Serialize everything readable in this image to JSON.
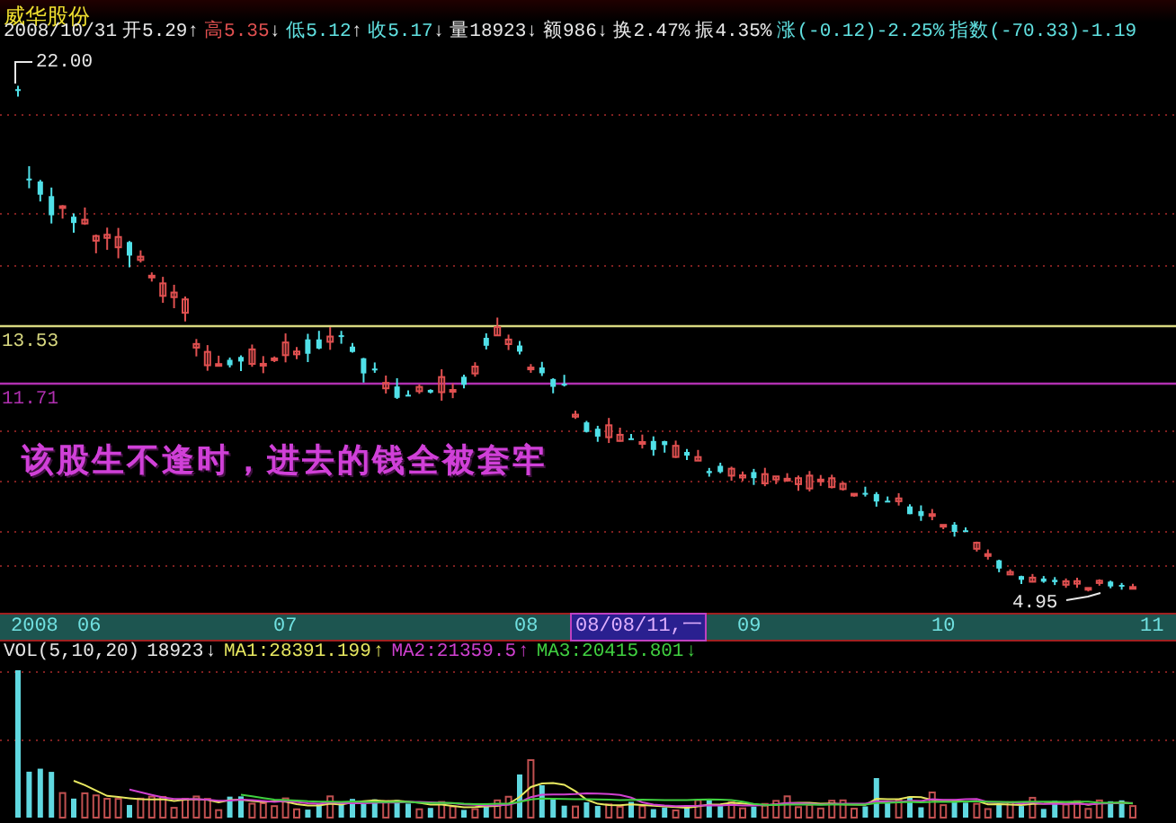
{
  "header": {
    "stock_name": "威华股份"
  },
  "quote": [
    {
      "text": "2008/10/31",
      "color": "#e8e8e8"
    },
    {
      "text": "开5.29",
      "arrow": "↑",
      "color": "#e8e8e8"
    },
    {
      "text": "高5.35",
      "arrow": "↓",
      "color": "#e05050"
    },
    {
      "text": "低5.12",
      "arrow": "↑",
      "color": "#60e0e0"
    },
    {
      "text": "收5.17",
      "arrow": "↓",
      "color": "#60e0e0"
    },
    {
      "text": "量18923",
      "arrow": "↓",
      "color": "#e8e8e8"
    },
    {
      "text": "额986",
      "arrow": "↓",
      "color": "#e8e8e8"
    },
    {
      "text": "换2.47%",
      "color": "#e8e8e8"
    },
    {
      "text": "振4.35%",
      "color": "#e8e8e8"
    },
    {
      "text": "涨(-0.12)-2.25%",
      "color": "#60e0e0"
    },
    {
      "text": "指数(-70.33)-1.19",
      "color": "#60e0e0"
    }
  ],
  "price_chart": {
    "markers": [
      {
        "kind": "high",
        "text": "22.00"
      },
      {
        "kind": "low",
        "text": "4.95"
      }
    ],
    "lines": [
      {
        "text": "13.53",
        "color": "#d8d880"
      },
      {
        "text": "11.71",
        "color": "#b030b0"
      }
    ],
    "annotation": "该股生不逢时，进去的钱全被套牢"
  },
  "date_axis": [
    {
      "text": "2008",
      "selected": false
    },
    {
      "text": "06",
      "selected": false
    },
    {
      "text": "07",
      "selected": false
    },
    {
      "text": "08",
      "selected": false
    },
    {
      "text": "08/08/11,一",
      "selected": true
    },
    {
      "text": "09",
      "selected": false
    },
    {
      "text": "10",
      "selected": false
    },
    {
      "text": "11",
      "selected": false
    }
  ],
  "volume": {
    "legend": [
      {
        "text": "VOL(5,10,20)",
        "color": "#e8e8e8"
      },
      {
        "text": "18923",
        "arrow": "↓",
        "color": "#e8e8e8"
      },
      {
        "text": "MA1:28391.199",
        "arrow": "↑",
        "color": "#e8e860"
      },
      {
        "text": "MA2:21359.5",
        "arrow": "↑",
        "color": "#d040d0"
      },
      {
        "text": "MA3:20415.801",
        "arrow": "↓",
        "color": "#40d040"
      }
    ]
  }
}
